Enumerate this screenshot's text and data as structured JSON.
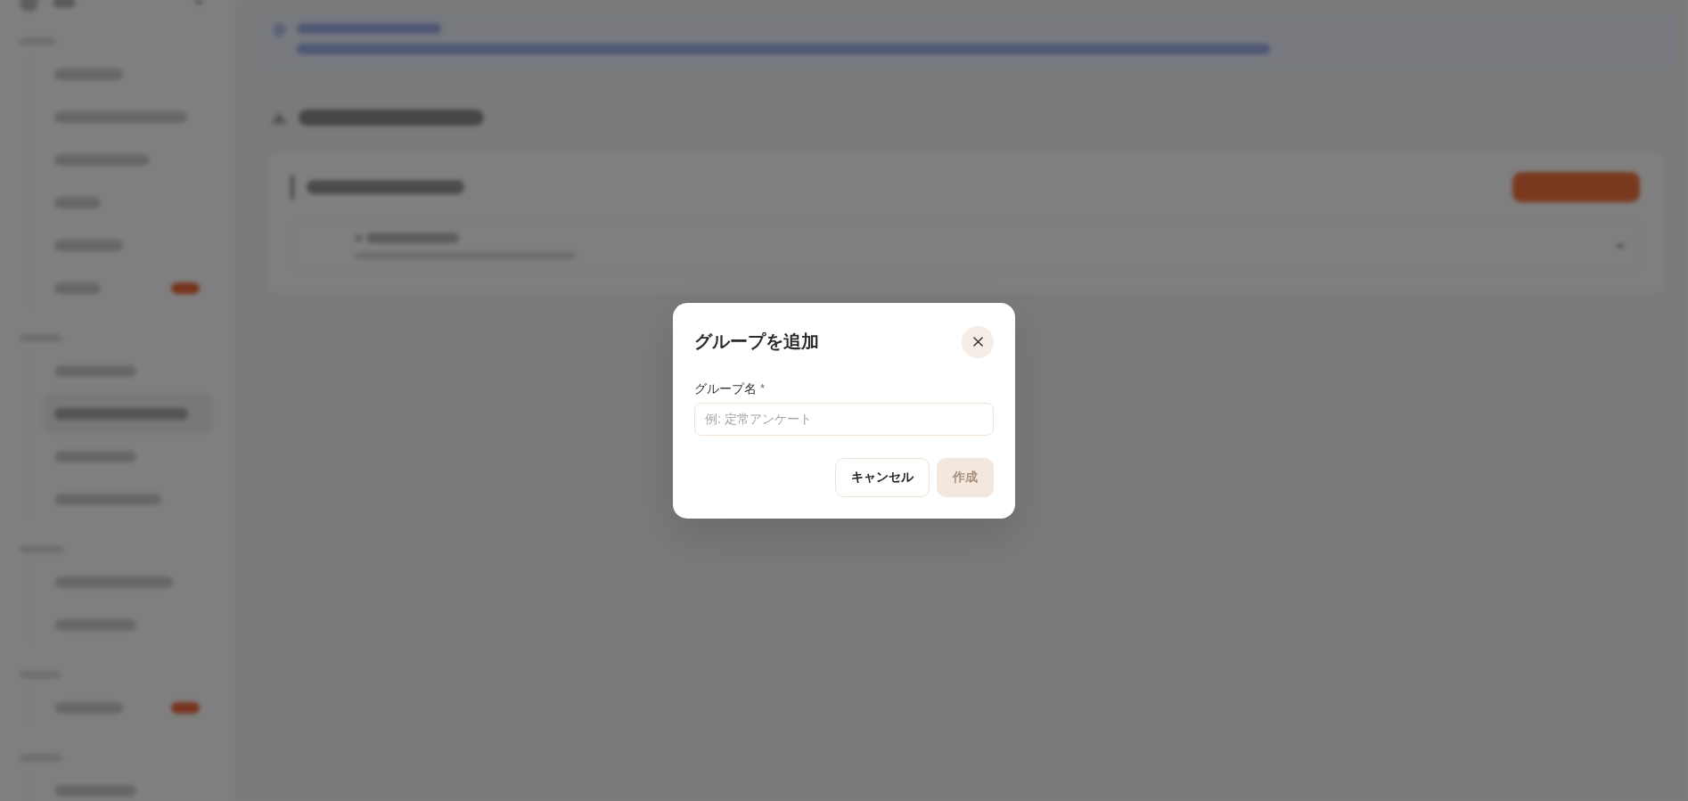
{
  "sidebar": {
    "sections": [
      {
        "items": [
          {
            "selected": false,
            "badge": false
          },
          {
            "selected": false,
            "badge": false
          },
          {
            "selected": false,
            "badge": false
          },
          {
            "selected": false,
            "badge": false
          },
          {
            "selected": false,
            "badge": false
          },
          {
            "selected": false,
            "badge": true
          }
        ]
      },
      {
        "items": [
          {
            "selected": false,
            "badge": false
          },
          {
            "selected": true,
            "badge": false
          },
          {
            "selected": false,
            "badge": false
          },
          {
            "selected": false,
            "badge": false
          }
        ]
      },
      {
        "items": [
          {
            "selected": false,
            "badge": false
          },
          {
            "selected": false,
            "badge": false
          }
        ]
      },
      {
        "items": [
          {
            "selected": false,
            "badge": true
          }
        ]
      },
      {
        "items": [
          {
            "selected": false,
            "badge": false
          }
        ]
      }
    ]
  },
  "dialog": {
    "title": "グループを追加",
    "field": {
      "label": "グループ名",
      "required_mark": "*",
      "placeholder": "例: 定常アンケート"
    },
    "buttons": [
      {
        "kind": "secondary",
        "label": "キャンセル",
        "disabled": false
      },
      {
        "kind": "primary",
        "label": "作成",
        "disabled": true
      }
    ]
  }
}
